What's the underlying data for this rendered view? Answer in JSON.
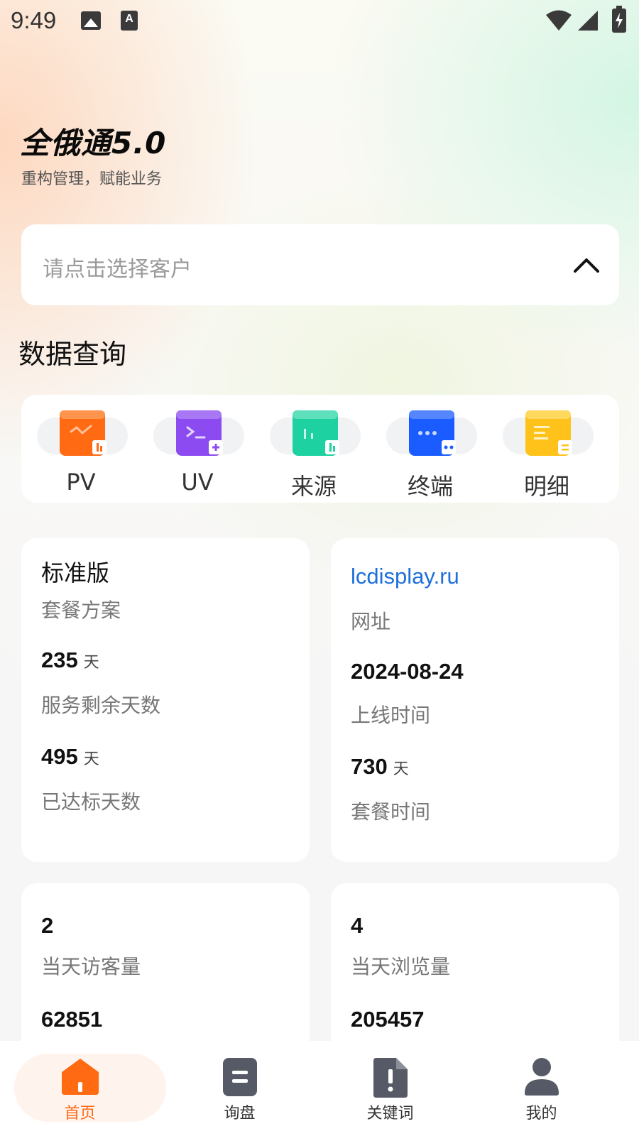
{
  "status_bar": {
    "time": "9:49",
    "font_icon_letter": "A"
  },
  "header": {
    "title": "全俄通5.0",
    "subtitle": "重构管理，赋能业务"
  },
  "customer_select": {
    "placeholder": "请点击选择客户"
  },
  "section_title": "数据查询",
  "quick_menu": [
    {
      "label": "PV",
      "icon": "pv-icon",
      "color": "#ff6a13"
    },
    {
      "label": "UV",
      "icon": "uv-icon",
      "color": "#8c4bf0"
    },
    {
      "label": "来源",
      "icon": "source-icon",
      "color": "#1dd1a1"
    },
    {
      "label": "终端",
      "icon": "terminal-icon",
      "color": "#1a5cff"
    },
    {
      "label": "明细",
      "icon": "detail-icon",
      "color": "#ffc21a"
    }
  ],
  "cards": {
    "plan": {
      "plan_name": "标准版",
      "plan_label": "套餐方案",
      "remaining_days": "235",
      "remaining_unit": "天",
      "remaining_label": "服务剩余天数",
      "achieved_days": "495",
      "achieved_unit": "天",
      "achieved_label": "已达标天数"
    },
    "site": {
      "url": "lcdisplay.ru",
      "url_label": "网址",
      "online_date": "2024-08-24",
      "online_label": "上线时间",
      "package_days": "730",
      "package_unit": "天",
      "package_label": "套餐时间"
    },
    "visitors": {
      "today_visitors": "2",
      "today_visitors_label": "当天访客量",
      "total_visitors": "62851"
    },
    "views": {
      "today_views": "4",
      "today_views_label": "当天浏览量",
      "total_views": "205457"
    }
  },
  "bottom_nav": [
    {
      "label": "首页",
      "icon": "home-icon",
      "active": true
    },
    {
      "label": "询盘",
      "icon": "inquiry-icon",
      "active": false
    },
    {
      "label": "关键词",
      "icon": "keyword-icon",
      "active": false
    },
    {
      "label": "我的",
      "icon": "profile-icon",
      "active": false
    }
  ],
  "colors": {
    "accent": "#ff6a13",
    "link": "#1e6fd9",
    "nav_icon": "#555a66"
  }
}
